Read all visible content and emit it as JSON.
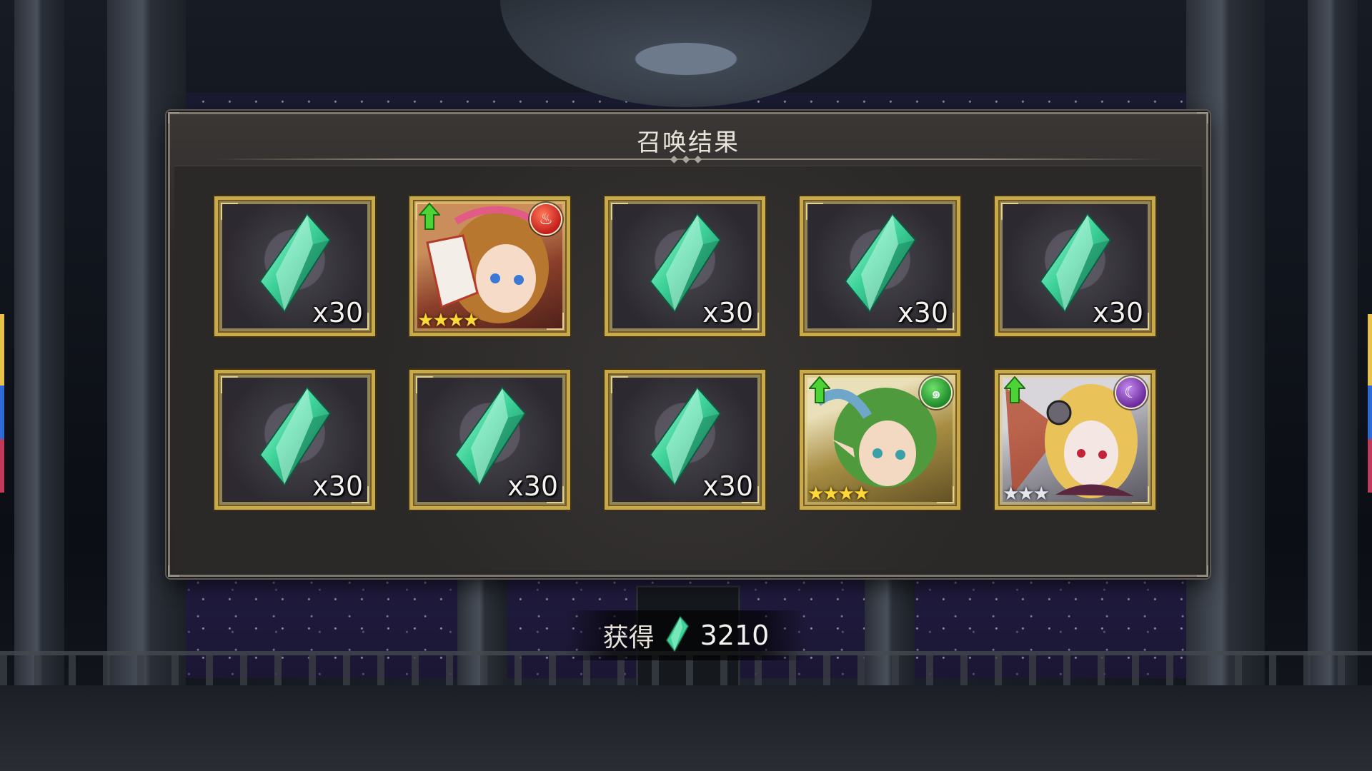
{
  "panel": {
    "title": "召唤结果"
  },
  "results": [
    {
      "type": "crystal",
      "quantity": "x30"
    },
    {
      "type": "character",
      "element": "fire-icon",
      "stars": 4,
      "star_color": "gold",
      "upgrade": true
    },
    {
      "type": "crystal",
      "quantity": "x30"
    },
    {
      "type": "crystal",
      "quantity": "x30"
    },
    {
      "type": "crystal",
      "quantity": "x30"
    },
    {
      "type": "crystal",
      "quantity": "x30"
    },
    {
      "type": "crystal",
      "quantity": "x30"
    },
    {
      "type": "crystal",
      "quantity": "x30"
    },
    {
      "type": "character",
      "element": "wind-icon",
      "stars": 4,
      "star_color": "gold",
      "upgrade": true
    },
    {
      "type": "character",
      "element": "dark-moon-icon",
      "stars": 3,
      "star_color": "silver",
      "upgrade": true
    }
  ],
  "obtained": {
    "label": "获得",
    "amount": "3210"
  },
  "colors": {
    "crystal": "#3fd39a",
    "frame_gold": "#c9a94a",
    "panel": "#2b2928"
  }
}
